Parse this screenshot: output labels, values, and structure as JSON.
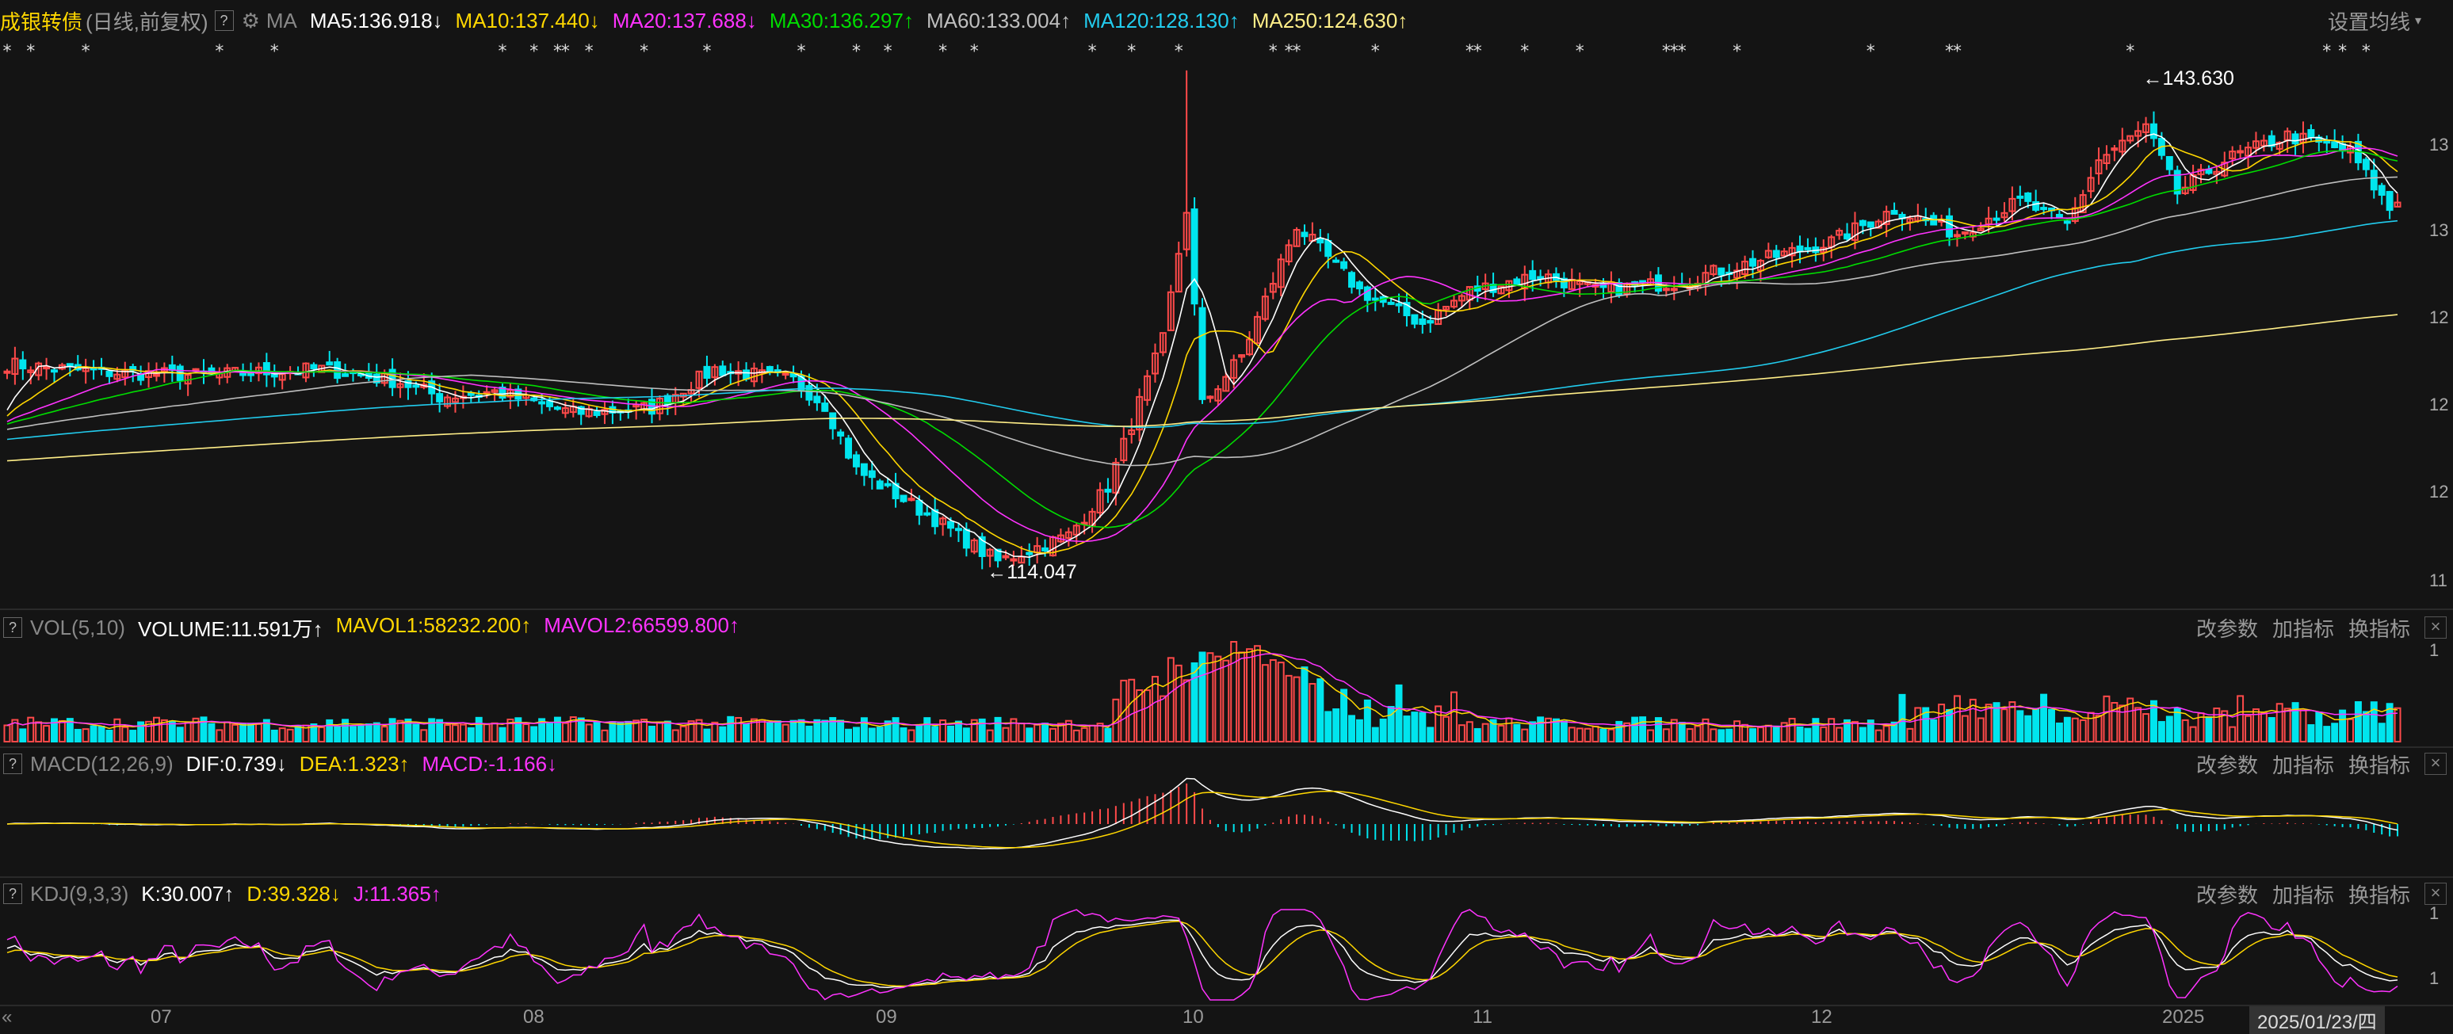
{
  "colors": {
    "up": "#ff4a4a",
    "down": "#00e5ee",
    "ma5": "#ffffff",
    "ma10": "#ffd700",
    "ma20": "#ff33ff",
    "ma30": "#00dd00",
    "ma60": "#bfbfbf",
    "ma120": "#22ccee",
    "ma250": "#ffee88"
  },
  "header": {
    "title": "成银转债",
    "subtitle": "(日线,前复权)",
    "help": "?",
    "gear_icon": "gear-icon",
    "ma_label": "MA",
    "ma_items": [
      {
        "label": "MA5:136.918",
        "arrow": "↓",
        "color": "#ffffff"
      },
      {
        "label": "MA10:137.440",
        "arrow": "↓",
        "color": "#ffd700"
      },
      {
        "label": "MA20:137.688",
        "arrow": "↓",
        "color": "#ff33ff"
      },
      {
        "label": "MA30:136.297",
        "arrow": "↑",
        "color": "#00dd00"
      },
      {
        "label": "MA60:133.004",
        "arrow": "↑",
        "color": "#bfbfbf"
      },
      {
        "label": "MA120:128.130",
        "arrow": "↑",
        "color": "#22ccee"
      },
      {
        "label": "MA250:124.630",
        "arrow": "↑",
        "color": "#ffee88"
      }
    ],
    "settings": "设置均线"
  },
  "annotations": {
    "high": "143.630",
    "low": "114.047",
    "y_labels": [
      "13",
      "13",
      "12",
      "12",
      "12",
      "11"
    ]
  },
  "vol": {
    "name": "VOL(5,10)",
    "items": [
      {
        "label": "VOLUME:11.591万",
        "arrow": "↑",
        "color": "#ffffff"
      },
      {
        "label": "MAVOL1:58232.200",
        "arrow": "↑",
        "color": "#ffd700"
      },
      {
        "label": "MAVOL2:66599.800",
        "arrow": "↑",
        "color": "#ff33ff"
      }
    ],
    "y_label": "1"
  },
  "macd": {
    "name": "MACD(12,26,9)",
    "items": [
      {
        "label": "DIF:0.739",
        "arrow": "↓",
        "color": "#ffffff"
      },
      {
        "label": "DEA:1.323",
        "arrow": "↑",
        "color": "#ffd700"
      },
      {
        "label": "MACD:-1.166",
        "arrow": "↓",
        "color": "#ff33ff"
      }
    ]
  },
  "kdj": {
    "name": "KDJ(9,3,3)",
    "items": [
      {
        "label": "K:30.007",
        "arrow": "↑",
        "color": "#ffffff"
      },
      {
        "label": "D:39.328",
        "arrow": "↓",
        "color": "#ffd700"
      },
      {
        "label": "J:11.365",
        "arrow": "↑",
        "color": "#ff33ff"
      }
    ],
    "y_labels": [
      "1",
      "1"
    ]
  },
  "panel_links": {
    "params": "改参数",
    "add": "加指标",
    "switch": "换指标",
    "close": "×"
  },
  "x_axis": {
    "labels": [
      "07",
      "08",
      "09",
      "10",
      "11",
      "12",
      "2025"
    ],
    "current": "2025/01/23/四",
    "nav": "«"
  },
  "chart_data": {
    "type": "candlestick",
    "title": "成银转债",
    "price_range": [
      112,
      146
    ],
    "high_point": 143.63,
    "low_point": 114.047,
    "series": [
      {
        "name": "MA5",
        "last": 136.918
      },
      {
        "name": "MA10",
        "last": 137.44
      },
      {
        "name": "MA20",
        "last": 137.688
      },
      {
        "name": "MA30",
        "last": 136.297
      },
      {
        "name": "MA60",
        "last": 133.004
      },
      {
        "name": "MA120",
        "last": 128.13
      },
      {
        "name": "MA250",
        "last": 124.63
      }
    ],
    "close_anchors": [
      [
        0,
        126.5
      ],
      [
        12,
        126.0
      ],
      [
        25,
        125.8
      ],
      [
        40,
        126.2
      ],
      [
        50,
        125.4
      ],
      [
        55,
        124.5
      ],
      [
        62,
        124.8
      ],
      [
        72,
        123.5
      ],
      [
        82,
        123.8
      ],
      [
        90,
        126.2
      ],
      [
        100,
        125.5
      ],
      [
        104,
        124.0
      ],
      [
        108,
        120.0
      ],
      [
        118,
        117.0
      ],
      [
        124,
        115.0
      ],
      [
        126,
        114.4
      ],
      [
        135,
        116.0
      ],
      [
        140,
        119.0
      ],
      [
        147,
        128.0
      ],
      [
        150,
        136.0
      ],
      [
        152,
        124.0
      ],
      [
        157,
        127.0
      ],
      [
        164,
        135.0
      ],
      [
        172,
        131.0
      ],
      [
        180,
        129.0
      ],
      [
        186,
        131.0
      ],
      [
        195,
        132.0
      ],
      [
        202,
        131.0
      ],
      [
        212,
        131.5
      ],
      [
        220,
        132.5
      ],
      [
        232,
        134.0
      ],
      [
        240,
        136.0
      ],
      [
        248,
        134.5
      ],
      [
        256,
        136.5
      ],
      [
        262,
        135.0
      ],
      [
        266,
        139.0
      ],
      [
        272,
        141.0
      ],
      [
        276,
        137.0
      ],
      [
        282,
        139.0
      ],
      [
        290,
        140.5
      ],
      [
        298,
        139.5
      ],
      [
        303,
        136.0
      ],
      [
        304,
        136.5
      ]
    ],
    "n_bars": 305,
    "ma5_count": 150,
    "volume": {
      "last": 115910,
      "mavol1": 58232.2,
      "mavol2": 66599.8
    },
    "macd": {
      "dif": 0.739,
      "dea": 1.323,
      "macd": -1.166
    },
    "kdj": {
      "k": 30.007,
      "d": 39.328,
      "j": 11.365
    }
  }
}
